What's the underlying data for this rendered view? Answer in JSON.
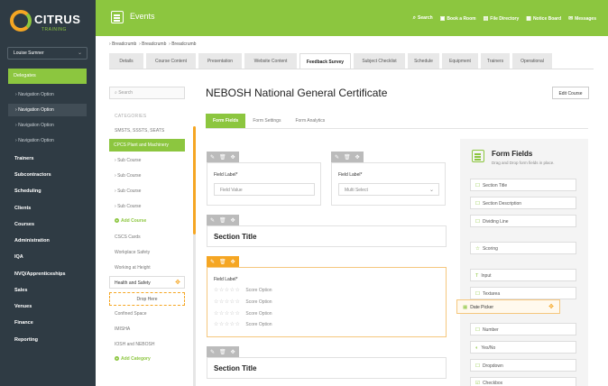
{
  "brand": {
    "name": "CITRUS",
    "sub": "TRAINING"
  },
  "user": {
    "name": "Louise Sumner"
  },
  "sidebar": {
    "active": "Delegates",
    "sub_items": [
      "Navigation Option",
      "Navigation Option",
      "Navigation Option",
      "Navigation Option"
    ],
    "items": [
      "Trainers",
      "Subcontractors",
      "Scheduling",
      "Clients",
      "Courses",
      "Administration",
      "IQA",
      "NVQ/Apprenticeships",
      "Sales",
      "Venues",
      "Finance",
      "Reporting"
    ]
  },
  "topbar": {
    "title": "Events",
    "links": [
      "Search",
      "Book a Room",
      "File Directory",
      "Notice Board",
      "Messages"
    ]
  },
  "breadcrumb": [
    "Breadcrumb",
    "Breadcrumb",
    "Breadcrumb"
  ],
  "tabs": [
    "Details",
    "Course Content",
    "Presentation",
    "Website Content",
    "Feedback Survey",
    "Subject Checklist",
    "Schedule",
    "Equipment",
    "Trainers",
    "Operational"
  ],
  "active_tab": "Feedback Survey",
  "course_list": {
    "search_placeholder": "Search",
    "category_label": "CATEGORIES",
    "items_top": [
      "SMSTS, SSSTS, SEATS"
    ],
    "active": "CPCS Plant and Machinery",
    "sub_courses": [
      "Sub Course",
      "Sub Course",
      "Sub Course",
      "Sub Course"
    ],
    "add_course": "Add Course",
    "items_bottom": [
      "CSCS Cards",
      "Workplace Safety",
      "Working at Height"
    ],
    "dragging": "Health and Safety",
    "drop_here": "Drop Here",
    "items_after": [
      "Confined Space",
      "IMISHA",
      "IOSH and NEBOSH"
    ],
    "add_category": "Add Category"
  },
  "main": {
    "heading": "NEBOSH National General Certificate",
    "edit_button": "Edit Course",
    "subtabs": [
      "Form Fields",
      "Form Settings",
      "Form Analytics"
    ],
    "field1": {
      "label": "Field Label*",
      "value": "Field Value"
    },
    "field2": {
      "label": "Field Label*",
      "value": "Multi Select"
    },
    "section1": "Section Title",
    "score_label": "Field Label*",
    "score_options": [
      "Score Option",
      "Score Option",
      "Score Option",
      "Score Option"
    ],
    "section2": "Section Title"
  },
  "panel": {
    "title": "Form Fields",
    "subtitle": "Drag and Drop form fields in place.",
    "items": [
      "Section Title",
      "Section Description",
      "Dividing Line",
      "Scoring",
      "Input",
      "Textarea",
      "Date Picker",
      "Number",
      "Yes/No",
      "Dropdown",
      "Checkbox"
    ]
  }
}
